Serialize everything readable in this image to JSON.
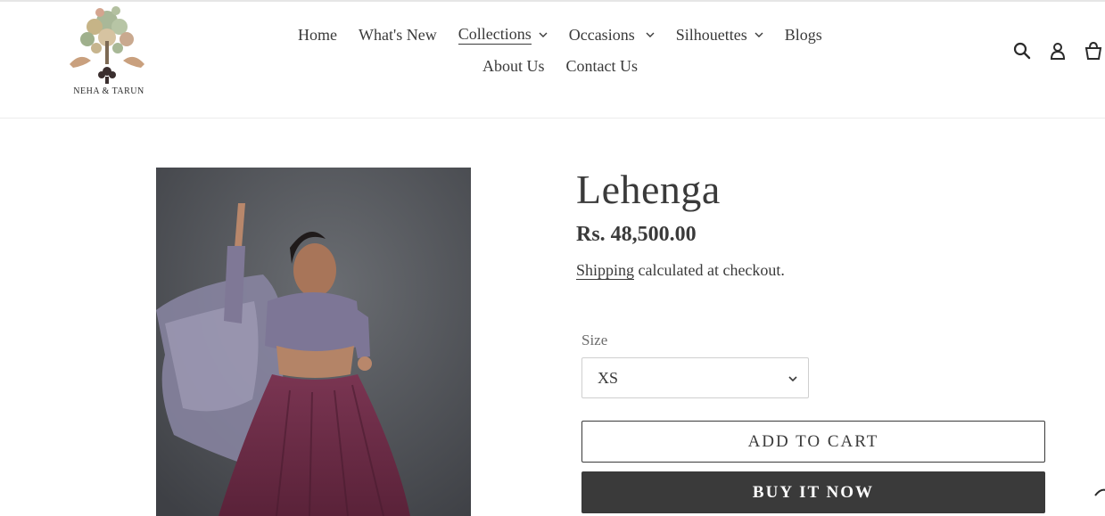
{
  "brand": {
    "name": "NEHA & TARUN"
  },
  "nav": {
    "row1": [
      {
        "label": "Home",
        "dropdown": false,
        "active": false
      },
      {
        "label": "What's New",
        "dropdown": false,
        "active": false
      },
      {
        "label": "Collections",
        "dropdown": true,
        "active": true
      },
      {
        "label": "Occasions",
        "dropdown": true,
        "active": false
      },
      {
        "label": "Silhouettes",
        "dropdown": true,
        "active": false
      },
      {
        "label": "Blogs",
        "dropdown": false,
        "active": false
      }
    ],
    "row2": [
      {
        "label": "About Us",
        "dropdown": false,
        "active": false
      },
      {
        "label": "Contact Us",
        "dropdown": false,
        "active": false
      }
    ]
  },
  "header_icons": [
    "search-icon",
    "account-icon",
    "cart-icon"
  ],
  "product": {
    "title": "Lehenga",
    "price": "Rs. 48,500.00",
    "shipping_link": "Shipping",
    "shipping_text": " calculated at checkout.",
    "size_label": "Size",
    "size_selected": "XS",
    "add_to_cart": "ADD TO CART",
    "buy_now": "BUY IT NOW"
  },
  "colors": {
    "text": "#3a3a3a",
    "button_dark": "#3a3a3a",
    "border": "#cfcfcf",
    "background": "#ffffff"
  }
}
